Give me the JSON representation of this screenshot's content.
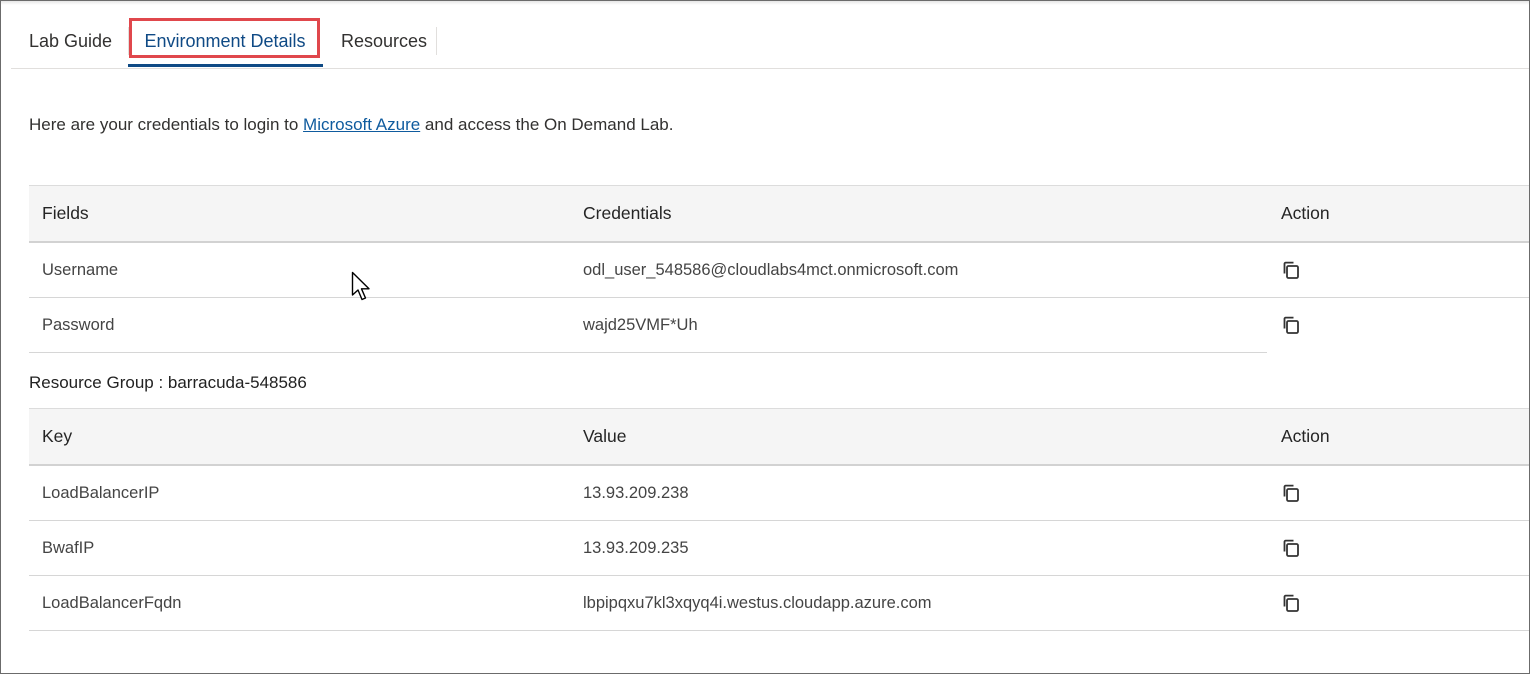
{
  "tabs": [
    {
      "label": "Lab Guide"
    },
    {
      "label": "Environment Details",
      "active": true
    },
    {
      "label": "Resources"
    }
  ],
  "intro": {
    "before": "Here are your credentials to login to ",
    "link": "Microsoft Azure",
    "after": " and access the On Demand Lab."
  },
  "credentials_table": {
    "headers": [
      "Fields",
      "Credentials",
      "Action"
    ],
    "rows": [
      {
        "field": "Username",
        "value": "odl_user_548586@cloudlabs4mct.onmicrosoft.com",
        "action_icon": "copy-icon"
      },
      {
        "field": "Password",
        "value": "wajd25VMF*Uh",
        "action_icon": "copy-icon"
      }
    ]
  },
  "resource_group": {
    "label": "Resource Group : barracuda-548586"
  },
  "resource_table": {
    "headers": [
      "Key",
      "Value",
      "Action"
    ],
    "rows": [
      {
        "key": "LoadBalancerIP",
        "value": "13.93.209.238",
        "action_icon": "copy-icon"
      },
      {
        "key": "BwafIP",
        "value": "13.93.209.235",
        "action_icon": "copy-icon"
      },
      {
        "key": "LoadBalancerFqdn",
        "value": "lbpipqxu7kl3xqyq4i.westus.cloudapp.azure.com",
        "action_icon": "copy-icon"
      }
    ]
  },
  "colors": {
    "active_tab": "#0f4a85",
    "highlight_box": "#e0474c",
    "link": "#0f5b9e",
    "header_bg": "#f5f5f5"
  }
}
